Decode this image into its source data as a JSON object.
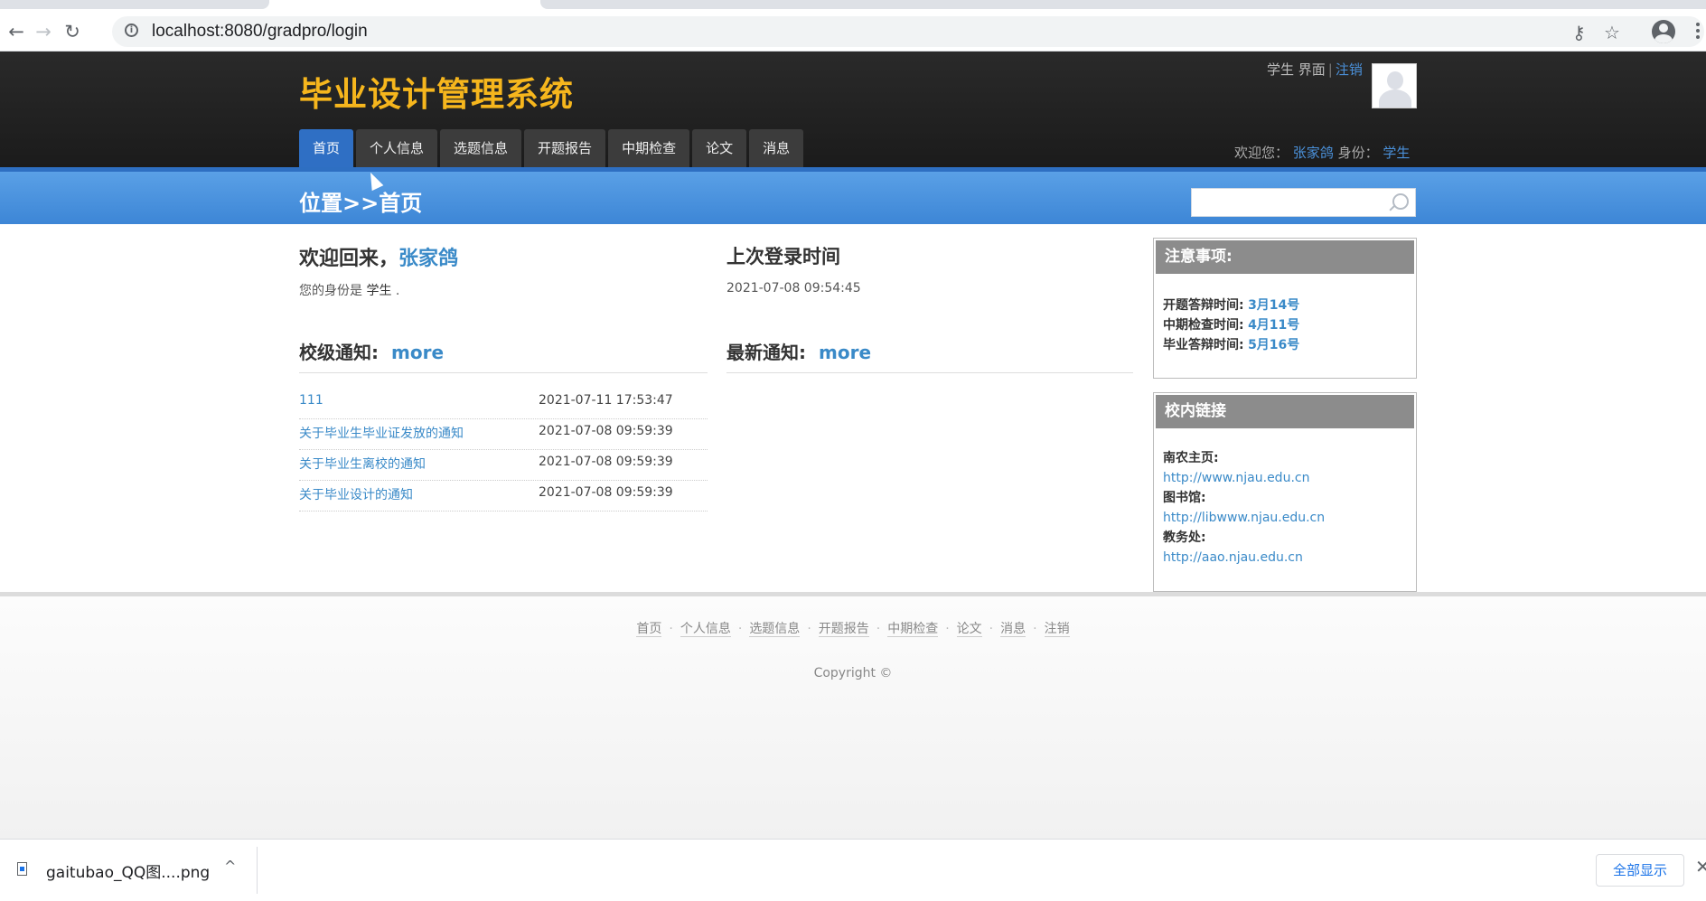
{
  "browser": {
    "url": "localhost:8080/gradpro/login",
    "icons": [
      "back-icon",
      "forward-icon",
      "reload-icon",
      "info-icon",
      "key-icon",
      "star-icon",
      "profile-icon",
      "menu-icon"
    ],
    "back_glyph": "←",
    "forward_glyph": "→",
    "reload_glyph": "↻",
    "info_glyph": "i",
    "key_glyph": "⚷",
    "star_glyph": "☆"
  },
  "header": {
    "title": "毕业设计管理系统",
    "top_right": {
      "role_text": "学生 界面",
      "sep": "|",
      "logout": "注销"
    },
    "welcome": {
      "prefix": "欢迎您：",
      "username": "张家鸽",
      "role_prefix": "身份：",
      "role": "学生"
    }
  },
  "nav": {
    "items": [
      {
        "label": "首页",
        "active": true
      },
      {
        "label": "个人信息",
        "active": false
      },
      {
        "label": "选题信息",
        "active": false
      },
      {
        "label": "开题报告",
        "active": false
      },
      {
        "label": "中期检查",
        "active": false
      },
      {
        "label": "论文",
        "active": false
      },
      {
        "label": "消息",
        "active": false
      }
    ]
  },
  "breadcrumb": {
    "text": "位置>>首页"
  },
  "search": {
    "placeholder": ""
  },
  "main": {
    "welcome_prefix": "欢迎回来，",
    "welcome_name": "张家鸽",
    "role_line_prefix": "您的身份是",
    "role_value": "学生",
    "role_suffix": ".",
    "last_login_title": "上次登录时间",
    "last_login_time": "2021-07-08 09:54:45",
    "school_notice_title": "校级通知:",
    "school_notice_more": "more",
    "latest_notice_title": "最新通知:",
    "latest_notice_more": "more",
    "notices": [
      {
        "title": "111",
        "time": "2021-07-11 17:53:47"
      },
      {
        "title": "关于毕业生毕业证发放的通知",
        "time": "2021-07-08 09:59:39"
      },
      {
        "title": "关于毕业生离校的通知",
        "time": "2021-07-08 09:59:39"
      },
      {
        "title": "关于毕业设计的通知",
        "time": "2021-07-08 09:59:39"
      }
    ]
  },
  "sidebar": {
    "notes": {
      "title": "注意事项:",
      "items": [
        {
          "label": "开题答辩时间:",
          "value": "3月14号"
        },
        {
          "label": "中期检查时间:",
          "value": "4月11号"
        },
        {
          "label": "毕业答辩时间:",
          "value": "5月16号"
        }
      ]
    },
    "links": {
      "title": "校内链接",
      "items": [
        {
          "label": "南农主页:",
          "url": "http://www.njau.edu.cn"
        },
        {
          "label": "图书馆:",
          "url": "http://libwww.njau.edu.cn"
        },
        {
          "label": "教务处:",
          "url": "http://aao.njau.edu.cn"
        }
      ]
    }
  },
  "footer": {
    "links": [
      "首页",
      "个人信息",
      "选题信息",
      "开题报告",
      "中期检查",
      "论文",
      "消息",
      "注销"
    ],
    "dot": "·",
    "copyright": "Copyright ©"
  },
  "downloads": {
    "file_name": "gaitubao_QQ图....png",
    "chevron": "^",
    "show_all": "全部显示",
    "close": "✕"
  },
  "colors": {
    "title_gold": "#f6b61d",
    "nav_active": "#2f6fc4",
    "link_blue": "#3a8ac8",
    "band_blue": "#4a93df"
  }
}
